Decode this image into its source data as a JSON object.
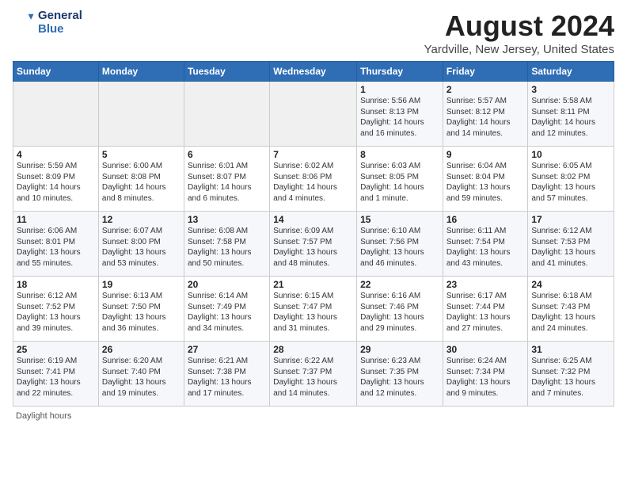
{
  "header": {
    "logo_line1": "General",
    "logo_line2": "Blue",
    "title": "August 2024",
    "subtitle": "Yardville, New Jersey, United States"
  },
  "days_of_week": [
    "Sunday",
    "Monday",
    "Tuesday",
    "Wednesday",
    "Thursday",
    "Friday",
    "Saturday"
  ],
  "weeks": [
    [
      {
        "day": "",
        "info": ""
      },
      {
        "day": "",
        "info": ""
      },
      {
        "day": "",
        "info": ""
      },
      {
        "day": "",
        "info": ""
      },
      {
        "day": "1",
        "info": "Sunrise: 5:56 AM\nSunset: 8:13 PM\nDaylight: 14 hours\nand 16 minutes."
      },
      {
        "day": "2",
        "info": "Sunrise: 5:57 AM\nSunset: 8:12 PM\nDaylight: 14 hours\nand 14 minutes."
      },
      {
        "day": "3",
        "info": "Sunrise: 5:58 AM\nSunset: 8:11 PM\nDaylight: 14 hours\nand 12 minutes."
      }
    ],
    [
      {
        "day": "4",
        "info": "Sunrise: 5:59 AM\nSunset: 8:09 PM\nDaylight: 14 hours\nand 10 minutes."
      },
      {
        "day": "5",
        "info": "Sunrise: 6:00 AM\nSunset: 8:08 PM\nDaylight: 14 hours\nand 8 minutes."
      },
      {
        "day": "6",
        "info": "Sunrise: 6:01 AM\nSunset: 8:07 PM\nDaylight: 14 hours\nand 6 minutes."
      },
      {
        "day": "7",
        "info": "Sunrise: 6:02 AM\nSunset: 8:06 PM\nDaylight: 14 hours\nand 4 minutes."
      },
      {
        "day": "8",
        "info": "Sunrise: 6:03 AM\nSunset: 8:05 PM\nDaylight: 14 hours\nand 1 minute."
      },
      {
        "day": "9",
        "info": "Sunrise: 6:04 AM\nSunset: 8:04 PM\nDaylight: 13 hours\nand 59 minutes."
      },
      {
        "day": "10",
        "info": "Sunrise: 6:05 AM\nSunset: 8:02 PM\nDaylight: 13 hours\nand 57 minutes."
      }
    ],
    [
      {
        "day": "11",
        "info": "Sunrise: 6:06 AM\nSunset: 8:01 PM\nDaylight: 13 hours\nand 55 minutes."
      },
      {
        "day": "12",
        "info": "Sunrise: 6:07 AM\nSunset: 8:00 PM\nDaylight: 13 hours\nand 53 minutes."
      },
      {
        "day": "13",
        "info": "Sunrise: 6:08 AM\nSunset: 7:58 PM\nDaylight: 13 hours\nand 50 minutes."
      },
      {
        "day": "14",
        "info": "Sunrise: 6:09 AM\nSunset: 7:57 PM\nDaylight: 13 hours\nand 48 minutes."
      },
      {
        "day": "15",
        "info": "Sunrise: 6:10 AM\nSunset: 7:56 PM\nDaylight: 13 hours\nand 46 minutes."
      },
      {
        "day": "16",
        "info": "Sunrise: 6:11 AM\nSunset: 7:54 PM\nDaylight: 13 hours\nand 43 minutes."
      },
      {
        "day": "17",
        "info": "Sunrise: 6:12 AM\nSunset: 7:53 PM\nDaylight: 13 hours\nand 41 minutes."
      }
    ],
    [
      {
        "day": "18",
        "info": "Sunrise: 6:12 AM\nSunset: 7:52 PM\nDaylight: 13 hours\nand 39 minutes."
      },
      {
        "day": "19",
        "info": "Sunrise: 6:13 AM\nSunset: 7:50 PM\nDaylight: 13 hours\nand 36 minutes."
      },
      {
        "day": "20",
        "info": "Sunrise: 6:14 AM\nSunset: 7:49 PM\nDaylight: 13 hours\nand 34 minutes."
      },
      {
        "day": "21",
        "info": "Sunrise: 6:15 AM\nSunset: 7:47 PM\nDaylight: 13 hours\nand 31 minutes."
      },
      {
        "day": "22",
        "info": "Sunrise: 6:16 AM\nSunset: 7:46 PM\nDaylight: 13 hours\nand 29 minutes."
      },
      {
        "day": "23",
        "info": "Sunrise: 6:17 AM\nSunset: 7:44 PM\nDaylight: 13 hours\nand 27 minutes."
      },
      {
        "day": "24",
        "info": "Sunrise: 6:18 AM\nSunset: 7:43 PM\nDaylight: 13 hours\nand 24 minutes."
      }
    ],
    [
      {
        "day": "25",
        "info": "Sunrise: 6:19 AM\nSunset: 7:41 PM\nDaylight: 13 hours\nand 22 minutes."
      },
      {
        "day": "26",
        "info": "Sunrise: 6:20 AM\nSunset: 7:40 PM\nDaylight: 13 hours\nand 19 minutes."
      },
      {
        "day": "27",
        "info": "Sunrise: 6:21 AM\nSunset: 7:38 PM\nDaylight: 13 hours\nand 17 minutes."
      },
      {
        "day": "28",
        "info": "Sunrise: 6:22 AM\nSunset: 7:37 PM\nDaylight: 13 hours\nand 14 minutes."
      },
      {
        "day": "29",
        "info": "Sunrise: 6:23 AM\nSunset: 7:35 PM\nDaylight: 13 hours\nand 12 minutes."
      },
      {
        "day": "30",
        "info": "Sunrise: 6:24 AM\nSunset: 7:34 PM\nDaylight: 13 hours\nand 9 minutes."
      },
      {
        "day": "31",
        "info": "Sunrise: 6:25 AM\nSunset: 7:32 PM\nDaylight: 13 hours\nand 7 minutes."
      }
    ]
  ],
  "footer": {
    "daylight_hours_label": "Daylight hours"
  }
}
